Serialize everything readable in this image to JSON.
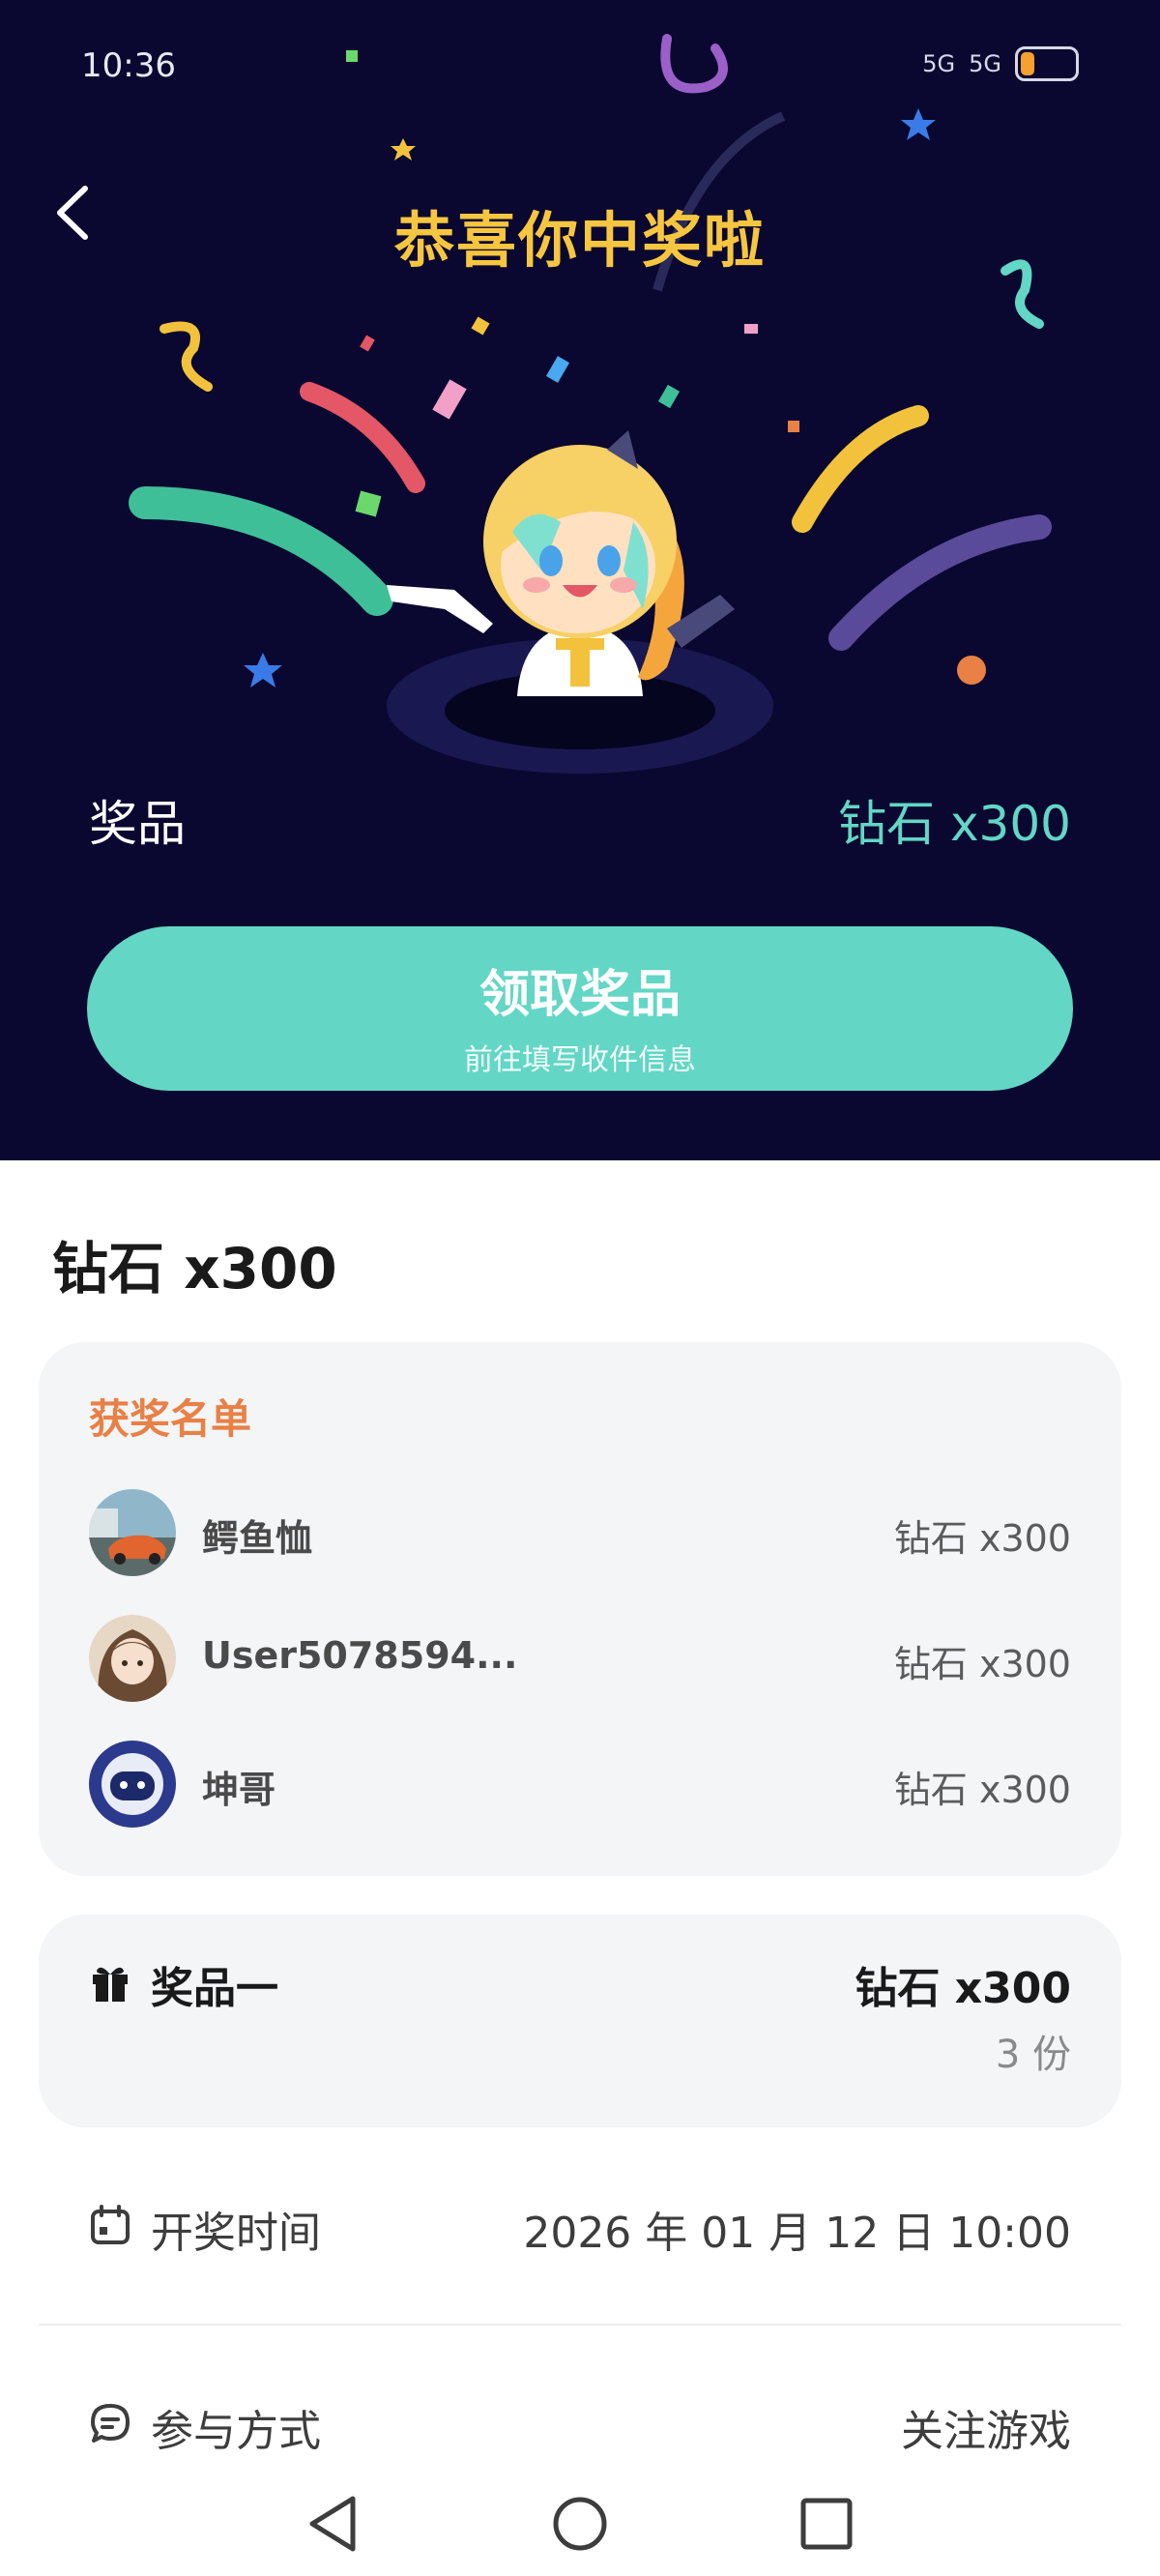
{
  "status": {
    "time": "10:36",
    "signal1": "5G",
    "signal2": "5G",
    "battery": "15"
  },
  "hero": {
    "title": "恭喜你中奖啦",
    "prize_label": "奖品",
    "prize_value": "钻石 x300",
    "claim_title": "领取奖品",
    "claim_sub": "前往填写收件信息"
  },
  "section_title": "钻石 x300",
  "winners": {
    "header": "获奖名单",
    "rows": [
      {
        "name": "鳄鱼恤",
        "prize": "钻石 x300"
      },
      {
        "name": "User5078594...",
        "prize": "钻石 x300"
      },
      {
        "name": "坤哥",
        "prize": "钻石 x300"
      }
    ]
  },
  "prize_card": {
    "label": "奖品一",
    "value": "钻石 x300",
    "qty": "3 份"
  },
  "draw_time": {
    "label": "开奖时间",
    "value": "2026 年 01 月 12 日 10:00"
  },
  "participate": {
    "label": "参与方式",
    "value": "关注游戏"
  },
  "colors": {
    "hero_bg": "#0a0830",
    "accent": "#63d6c5",
    "title_gold": "#f7c640",
    "winner_header": "#e98046"
  }
}
